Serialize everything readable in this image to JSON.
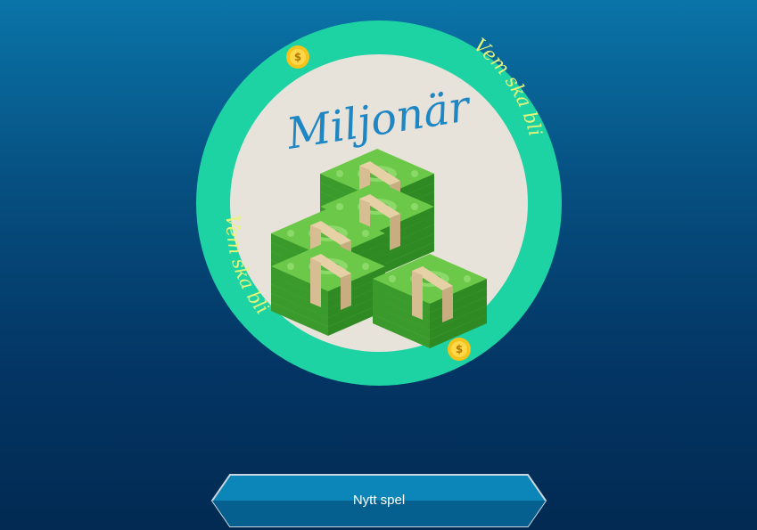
{
  "game": {
    "logo": {
      "title": "Miljonär",
      "ring_text_top": "Vem ska bli",
      "ring_text_bottom": "Vem ska bli",
      "coin_symbol": "$"
    },
    "new_game_button": {
      "label": "Nytt spel"
    }
  },
  "colors": {
    "background_top": "#0a74a8",
    "background_bottom": "#022a52",
    "ring": "#1ed3a3",
    "logo_inner": "#e8e3da",
    "title_text": "#1f86c4",
    "ring_text": "#e6f47a",
    "coin": "#f6c21c",
    "button_fill": "#0e7bab"
  },
  "icons": [
    "money-stack-icon",
    "coin-icon"
  ]
}
